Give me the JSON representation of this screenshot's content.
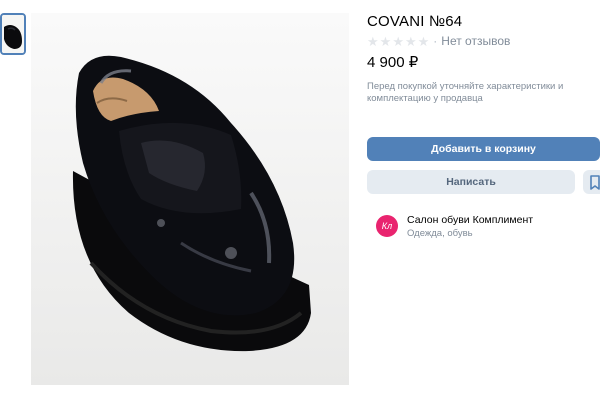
{
  "product": {
    "title": "COVANI №64",
    "rating_stars": 0,
    "rating_max": 5,
    "reviews_label": "Нет отзывов",
    "price": "4 900 ₽",
    "note": "Перед покупкой уточняйте характеристики и комплектацию у продавца"
  },
  "actions": {
    "add_to_cart": "Добавить в корзину",
    "message": "Написать"
  },
  "shop": {
    "avatar_text": "Кл",
    "name": "Салон обуви Комплимент",
    "category": "Одежда, обувь"
  },
  "icons": {
    "star": "star-icon",
    "bookmark": "bookmark-icon"
  },
  "colors": {
    "accent": "#5181b8",
    "secondary_bg": "#e5ebf1",
    "muted_text": "#818c99",
    "avatar": "#e9246f"
  }
}
